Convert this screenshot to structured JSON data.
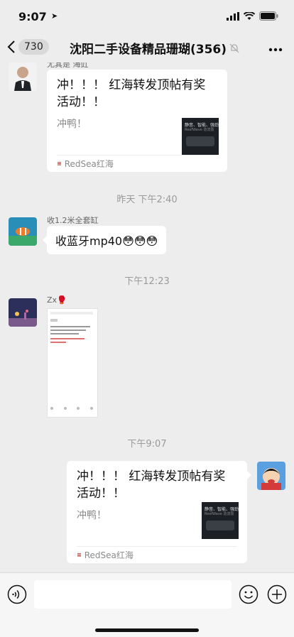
{
  "status": {
    "time": "9:07"
  },
  "nav": {
    "back_count": "730",
    "title": "沈阳二手设备精品珊瑚(356)"
  },
  "messages": {
    "m1": {
      "sender": "尤其是 海豇",
      "title": "冲！！！ 红海转发顶帖有奖活动！！",
      "desc": "冲鸭！",
      "thumb_text_line1": "静音、智能、强劲",
      "thumb_text_line2": "ReefWave 造流泵",
      "source": "RedSea红海"
    },
    "time1": "昨天 下午2:40",
    "m2": {
      "sender": "收1.2米全套缸",
      "text": "收蓝牙mp40😳😳😳"
    },
    "time2": "下午12:23",
    "m3": {
      "sender": "Zx🥊"
    },
    "time3": "下午9:07",
    "m4": {
      "title": "冲！！！ 红海转发顶帖有奖活动！！",
      "desc": "冲鸭！",
      "thumb_text_line1": "静音、智能、强劲",
      "thumb_text_line2": "ReefWave 造流泵",
      "source": "RedSea红海"
    }
  },
  "icons": {
    "voice": "voice-icon",
    "emoji": "emoji-icon",
    "plus": "plus-icon"
  }
}
